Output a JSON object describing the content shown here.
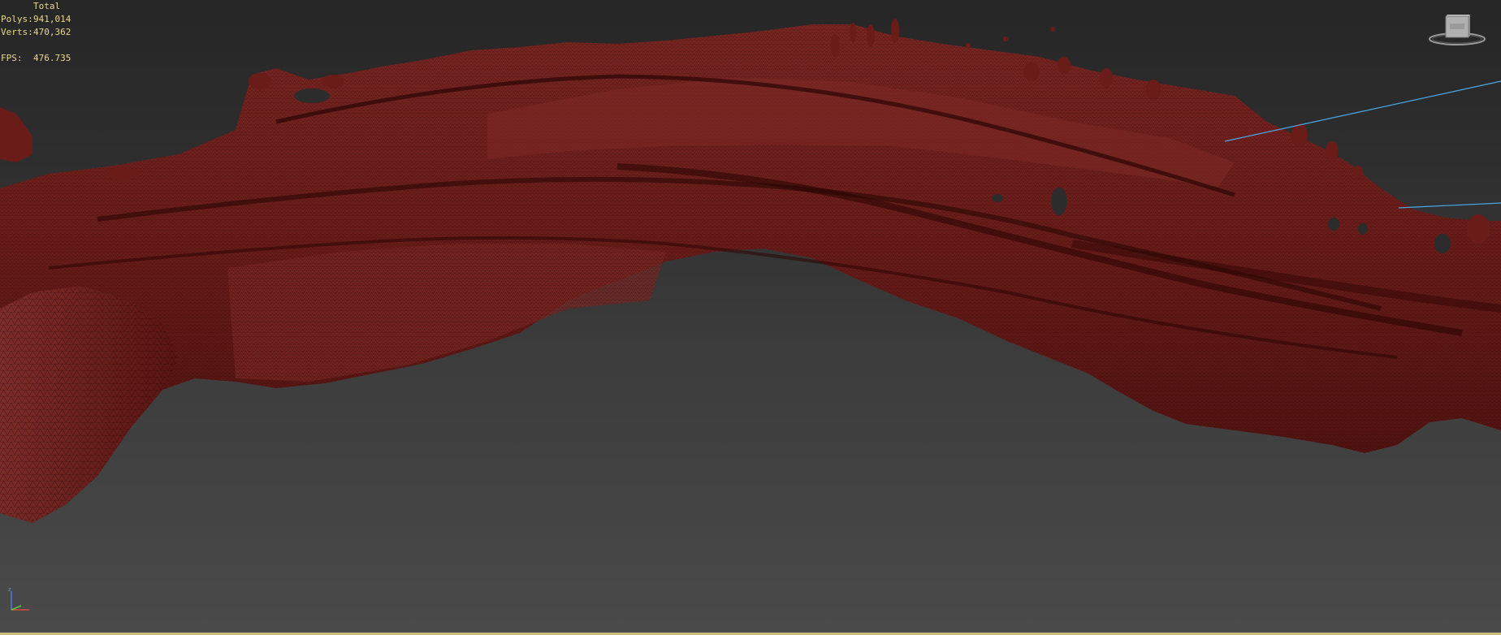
{
  "viewport_stats": {
    "header": "Total",
    "polys_label": "Polys:",
    "polys_value": "941,014",
    "verts_label": "Verts:",
    "verts_value": "470,362",
    "fps_label": "FPS:",
    "fps_value": "476.735"
  },
  "viewcube": {
    "icon": "viewcube-icon"
  },
  "axis_tripod": {
    "icon": "axis-tripod-icon",
    "z_label": "z"
  },
  "colors": {
    "mesh_fill": "#6e1c1a",
    "mesh_dark": "#3a0a08",
    "wire": "#1a0404",
    "stats_text": "#e8d88a",
    "guide_line": "#4aa8e8",
    "viewport_frame": "#c8bc78"
  }
}
